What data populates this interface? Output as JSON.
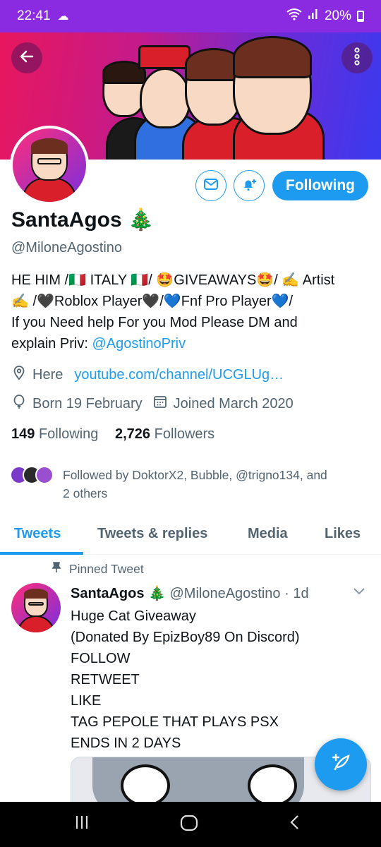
{
  "status_bar": {
    "time": "22:41",
    "battery": "20%"
  },
  "profile": {
    "name": "SantaAgos 🎄",
    "handle": "@MiloneAgostino",
    "following_label": "Following",
    "bio_line1": "HE HIM /🇮🇹 ITALY 🇮🇹/ 🤩GIVEAWAYS🤩/ ✍️ Artist",
    "bio_line2": "✍️ /🖤Roblox Player🖤/💙Fnf Pro Player💙/",
    "bio_line3": "If you Need help For you Mod Please DM and",
    "bio_line4_text": "explain Priv: ",
    "bio_link": "@AgostinoPriv",
    "location": "Here",
    "website": "youtube.com/channel/UCGLUg…",
    "birthday": "Born 19 February",
    "joined": "Joined March 2020",
    "following_count": "149",
    "following_text": "Following",
    "followers_count": "2,726",
    "followers_text": "Followers",
    "followed_by_line1": "Followed by DoktorX2, Bubble, @trigno134, and",
    "followed_by_line2": "2 others"
  },
  "tabs": [
    "Tweets",
    "Tweets & replies",
    "Media",
    "Likes"
  ],
  "pinned_tweet": {
    "label": "Pinned Tweet",
    "name": "SantaAgos 🎄",
    "handle": "@MiloneAgostino",
    "time": "· 1d",
    "lines": [
      "Huge Cat Giveaway",
      "(Donated By EpizBoy89 On Discord)",
      "FOLLOW",
      "RETWEET",
      "LIKE",
      "TAG PEPOLE THAT PLAYS PSX",
      "ENDS IN 2 DAYS"
    ]
  },
  "icons": {
    "back": "back-arrow-icon",
    "more": "more-vertical-icon",
    "message": "envelope-icon",
    "notify": "bell-plus-icon",
    "location": "location-pin-icon",
    "birthday": "balloon-icon",
    "calendar": "calendar-icon",
    "pin": "pin-icon",
    "compose": "compose-icon"
  },
  "colors": {
    "accent": "#1d9bf0",
    "status_bar": "#8a2be2"
  }
}
